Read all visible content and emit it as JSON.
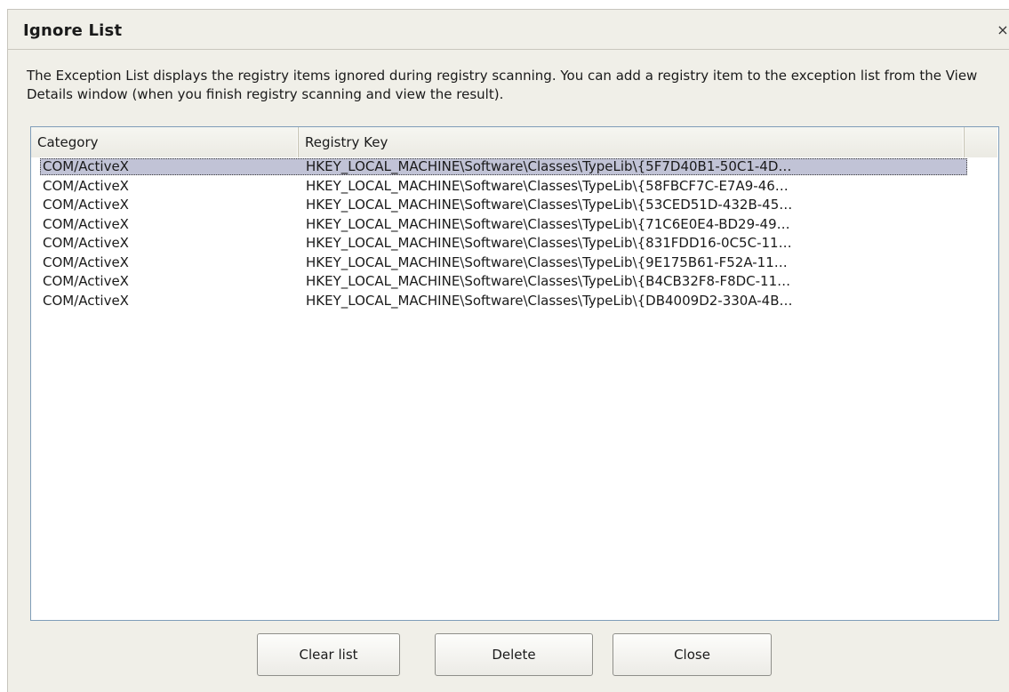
{
  "window": {
    "title": "Ignore List",
    "close_glyph": "×"
  },
  "description": "The Exception List displays the registry items ignored during registry scanning. You can add a registry item to the exception list from the View Details window (when you finish registry scanning and view the result).",
  "list": {
    "columns": [
      "Category",
      "Registry Key"
    ],
    "selected_index": 0,
    "rows": [
      {
        "category": "COM/ActiveX",
        "key": "HKEY_LOCAL_MACHINE\\Software\\Classes\\TypeLib\\{5F7D40B1-50C1-4D…"
      },
      {
        "category": "COM/ActiveX",
        "key": "HKEY_LOCAL_MACHINE\\Software\\Classes\\TypeLib\\{58FBCF7C-E7A9-46…"
      },
      {
        "category": "COM/ActiveX",
        "key": "HKEY_LOCAL_MACHINE\\Software\\Classes\\TypeLib\\{53CED51D-432B-45…"
      },
      {
        "category": "COM/ActiveX",
        "key": "HKEY_LOCAL_MACHINE\\Software\\Classes\\TypeLib\\{71C6E0E4-BD29-49…"
      },
      {
        "category": "COM/ActiveX",
        "key": "HKEY_LOCAL_MACHINE\\Software\\Classes\\TypeLib\\{831FDD16-0C5C-11…"
      },
      {
        "category": "COM/ActiveX",
        "key": "HKEY_LOCAL_MACHINE\\Software\\Classes\\TypeLib\\{9E175B61-F52A-11…"
      },
      {
        "category": "COM/ActiveX",
        "key": "HKEY_LOCAL_MACHINE\\Software\\Classes\\TypeLib\\{B4CB32F8-F8DC-11…"
      },
      {
        "category": "COM/ActiveX",
        "key": "HKEY_LOCAL_MACHINE\\Software\\Classes\\TypeLib\\{DB4009D2-330A-4B…"
      }
    ]
  },
  "buttons": {
    "clear_label": "Clear list",
    "delete_label": "Delete",
    "close_label": "Close"
  },
  "colors": {
    "dialog_bg": "#f0efe8",
    "selection": "#c1c3d6",
    "list_border": "#7f9db9"
  }
}
